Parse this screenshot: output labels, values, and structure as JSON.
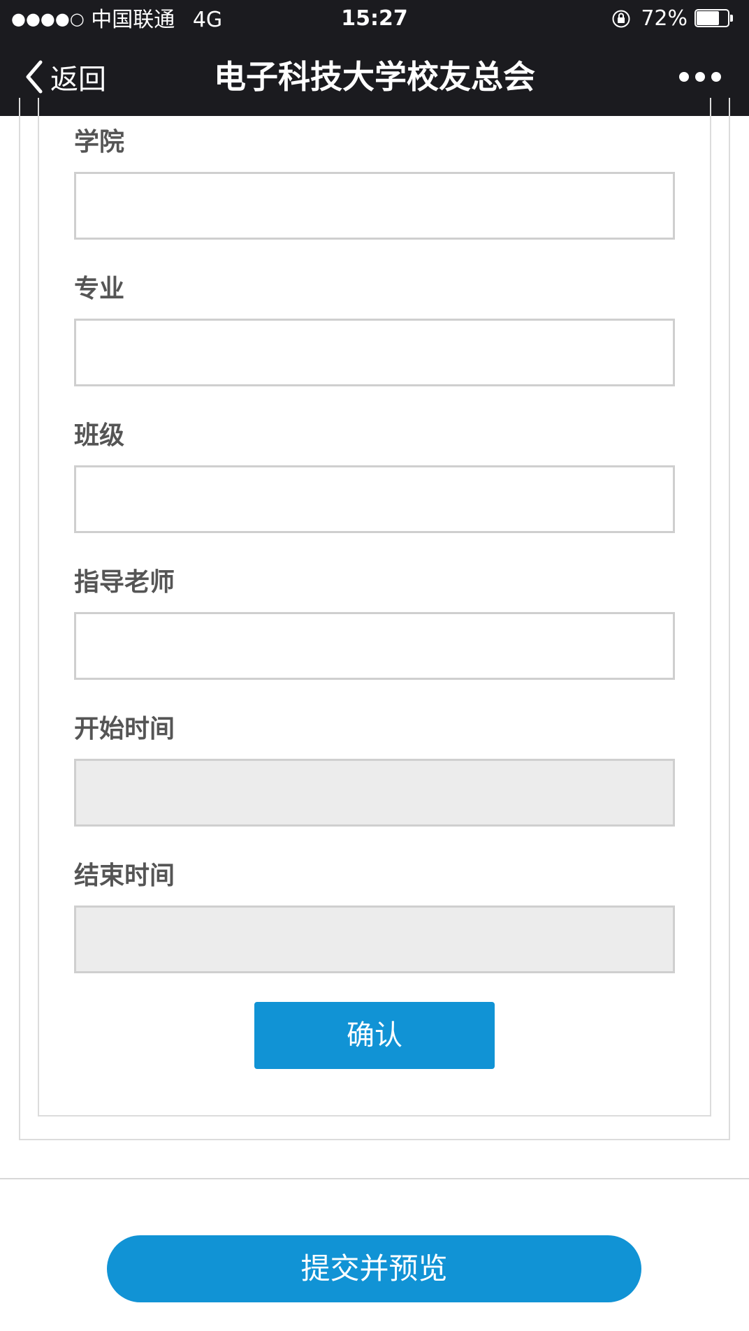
{
  "status_bar": {
    "signal": "●●●●○",
    "carrier": "中国联通",
    "network": "4G",
    "time": "15:27",
    "battery_percent": "72%",
    "battery_level": 0.72
  },
  "nav": {
    "back_label": "返回",
    "title": "电子科技大学校友总会"
  },
  "form": {
    "fields": [
      {
        "label": "学院",
        "value": "",
        "disabled": false
      },
      {
        "label": "专业",
        "value": "",
        "disabled": false
      },
      {
        "label": "班级",
        "value": "",
        "disabled": false
      },
      {
        "label": "指导老师",
        "value": "",
        "disabled": false
      },
      {
        "label": "开始时间",
        "value": "",
        "disabled": true
      },
      {
        "label": "结束时间",
        "value": "",
        "disabled": true
      }
    ],
    "confirm_label": "确认"
  },
  "footer": {
    "submit_label": "提交并预览"
  },
  "colors": {
    "accent": "#1193d5",
    "nav_bg": "#1b1b1f",
    "disabled_bg": "#ececec"
  }
}
